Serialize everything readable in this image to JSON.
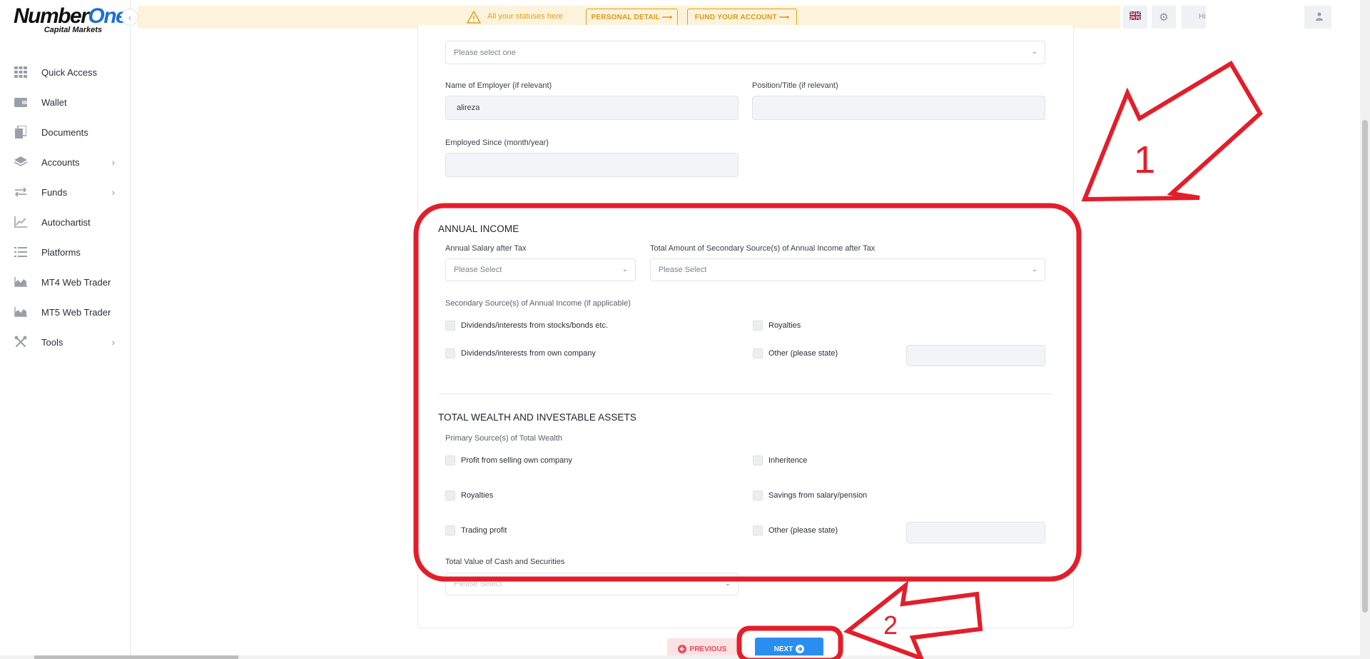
{
  "brand": {
    "name_part1": "Number",
    "name_part2": "One",
    "tagline": "Capital Markets"
  },
  "sidebar": {
    "items": [
      {
        "label": "Quick Access",
        "icon": "grid-icon",
        "has_submenu": false
      },
      {
        "label": "Wallet",
        "icon": "wallet-icon",
        "has_submenu": false
      },
      {
        "label": "Documents",
        "icon": "documents-icon",
        "has_submenu": false
      },
      {
        "label": "Accounts",
        "icon": "layers-icon",
        "has_submenu": true
      },
      {
        "label": "Funds",
        "icon": "transfer-icon",
        "has_submenu": true
      },
      {
        "label": "Autochartist",
        "icon": "chart-line-icon",
        "has_submenu": false
      },
      {
        "label": "Platforms",
        "icon": "list-icon",
        "has_submenu": false
      },
      {
        "label": "MT4 Web Trader",
        "icon": "area-chart-icon",
        "has_submenu": false
      },
      {
        "label": "MT5 Web Trader",
        "icon": "area-chart-icon",
        "has_submenu": false
      },
      {
        "label": "Tools",
        "icon": "tools-icon",
        "has_submenu": true
      }
    ]
  },
  "topbar": {
    "status_text": "All your statuses here",
    "personal_detail_btn": "PERSONAL DETAIL ⟶",
    "fund_account_btn": "FUND YOUR ACCOUNT ⟶",
    "greeting": "Hi,",
    "language_flag": "uk-flag-icon"
  },
  "employment": {
    "select_placeholder": "Please select one",
    "employer_label": "Name of Employer (if relevant)",
    "employer_value": "alireza",
    "position_label": "Position/Title (if relevant)",
    "position_value": "",
    "employed_since_label": "Employed Since (month/year)",
    "employed_since_value": ""
  },
  "annual_income": {
    "title": "ANNUAL INCOME",
    "salary_label": "Annual Salary after Tax",
    "salary_placeholder": "Please Select",
    "secondary_total_label": "Total Amount of Secondary Source(s) of Annual Income after Tax",
    "secondary_total_placeholder": "Please Select",
    "secondary_sources_label": "Secondary Source(s) of Annual Income (if applicable)",
    "options": {
      "dividends_stocks": "Dividends/interests from stocks/bonds etc.",
      "royalties": "Royalties",
      "dividends_company": "Dividends/interests from own company",
      "other": "Other (please state)"
    },
    "other_value": ""
  },
  "wealth": {
    "title": "TOTAL WEALTH AND INVESTABLE ASSETS",
    "primary_label": "Primary Source(s) of Total Wealth",
    "options": {
      "selling_company": "Profit from selling own company",
      "inheritence": "Inheritence",
      "royalties": "Royalties",
      "savings": "Savings from salary/pension",
      "trading": "Trading profit",
      "other": "Other (please state)"
    },
    "other_value": "",
    "cash_label": "Total Value of Cash and Securities",
    "cash_placeholder": "Please Select"
  },
  "navigation": {
    "previous": "PREVIOUS",
    "next": "NEXT"
  },
  "annotations": {
    "label_1": "1",
    "label_2": "2",
    "color": "#e31e2a"
  },
  "colors": {
    "accent": "#2a8ef0",
    "warning": "#e0a21a",
    "danger": "#e44a59"
  }
}
